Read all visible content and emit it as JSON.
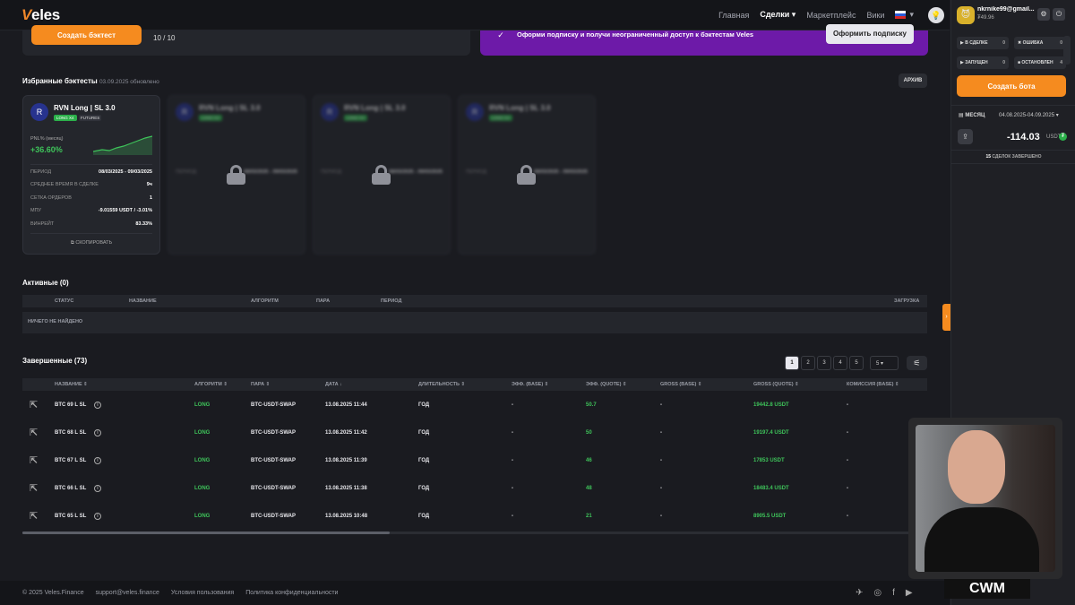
{
  "header": {
    "logo_mark": "V",
    "logo_text": "eles",
    "nav": [
      {
        "label": "Главная"
      },
      {
        "label": "Сделки ▾"
      },
      {
        "label": "Маркетплейс"
      },
      {
        "label": "Вики"
      }
    ],
    "lang_caret": "▾"
  },
  "topcard": {
    "create_backtest": "Создать бэктест",
    "count": "10 / 10"
  },
  "promo": {
    "text": "Оформи подписку и получи неограниченный доступ к бэктестам Veles",
    "button": "Оформить подписку",
    "check": "✓"
  },
  "favorites": {
    "title": "Избранные бэктесты",
    "updated": "03.09.2025 обновлено",
    "archive": "АРХИВ"
  },
  "card": {
    "name": "RVN Long | SL 3.0",
    "tag_long": "LONG X4",
    "tag_futures": "FUTURES",
    "pnl_label": "PNL% (месяц)",
    "pnl_value": "+36.60%",
    "rows": [
      {
        "label": "ПЕРИОД",
        "value": "08/03/2025 - 09/03/2025"
      },
      {
        "label": "СРЕДНЕЕ ВРЕМЯ В СДЕЛКЕ",
        "value": "9ч"
      },
      {
        "label": "СЕТКА ОРДЕРОВ",
        "value": "1"
      },
      {
        "label": "МПУ",
        "value": "-9.01559 USDT / -3.01%"
      },
      {
        "label": "ВИНРЕЙТ",
        "value": "83.33%"
      }
    ],
    "copy": "СКОПИРОВАТЬ",
    "icon": "R"
  },
  "locked_card": {
    "name": "RVN Long | SL 3.0",
    "tag": "LONG X4",
    "row_label": "ПЕРИОД",
    "row_value": "08/03/2025 - 09/03/2025"
  },
  "active": {
    "title": "Активные (0)",
    "columns": [
      "СТАТУС",
      "НАЗВАНИЕ",
      "АЛГОРИТМ",
      "ПАРА",
      "ПЕРИОД",
      "ЗАГРУЗКА"
    ],
    "empty": "НИЧЕГО НЕ НАЙДЕНО"
  },
  "completed": {
    "title": "Завершенные (73)",
    "pages": [
      "1",
      "2",
      "3",
      "4",
      "5"
    ],
    "page_size": "5 ▾",
    "filter_icon": "⚟",
    "columns": [
      "НАЗВАНИЕ ⇕",
      "АЛГОРИТМ ⇕",
      "ПАРА ⇕",
      "ДАТА ↓",
      "ДЛИТЕЛЬНОСТЬ ⇕",
      "ЭФФ. (BASE) ⇕",
      "ЭФФ. (QUOTE) ⇕",
      "GROSS (BASE) ⇕",
      "GROSS (QUOTE) ⇕",
      "КОМИССИЯ (BASE) ⇕"
    ],
    "rows": [
      {
        "name": "BTC 69 L SL",
        "algo": "LONG",
        "pair": "BTC-USDT-SWAP",
        "date": "13.08.2025 11:44",
        "dur": "ГОД",
        "eff_base": "-",
        "eff_quote": "50.7",
        "gross_base": "-",
        "gross_quote": "19442.8 USDT",
        "fee": "-"
      },
      {
        "name": "BTC 68 L SL",
        "algo": "LONG",
        "pair": "BTC-USDT-SWAP",
        "date": "13.08.2025 11:42",
        "dur": "ГОД",
        "eff_base": "-",
        "eff_quote": "50",
        "gross_base": "-",
        "gross_quote": "19197.4 USDT",
        "fee": "-"
      },
      {
        "name": "BTC 67 L SL",
        "algo": "LONG",
        "pair": "BTC-USDT-SWAP",
        "date": "13.08.2025 11:39",
        "dur": "ГОД",
        "eff_base": "-",
        "eff_quote": "46",
        "gross_base": "-",
        "gross_quote": "17853 USDT",
        "fee": "-"
      },
      {
        "name": "BTC 66 L SL",
        "algo": "LONG",
        "pair": "BTC-USDT-SWAP",
        "date": "13.08.2025 11:38",
        "dur": "ГОД",
        "eff_base": "-",
        "eff_quote": "48",
        "gross_base": "-",
        "gross_quote": "18483.4 USDT",
        "fee": "-"
      },
      {
        "name": "BTC 65 L SL",
        "algo": "LONG",
        "pair": "BTC-USDT-SWAP",
        "date": "13.08.2025 10:48",
        "dur": "ГОД",
        "eff_base": "-",
        "eff_quote": "21",
        "gross_base": "-",
        "gross_quote": "8905.5 USDT",
        "fee": "-"
      }
    ]
  },
  "footer": {
    "links": [
      "© 2025 Veles.Finance",
      "support@veles.finance",
      "Условия пользования",
      "Политика конфиденциальности"
    ],
    "social": [
      "✈",
      "◎",
      "f",
      "▶"
    ]
  },
  "sidebar": {
    "email": "nkrnike99@gmail...",
    "balance": "₮49.96",
    "stats": [
      {
        "label": "▶ В СДЕЛКЕ",
        "n": "0"
      },
      {
        "label": "✖ ОШИБКА",
        "n": "0"
      },
      {
        "label": "▶ ЗАПУЩЕН",
        "n": "0"
      },
      {
        "label": "■ ОСТАНОВЛЕН",
        "n": "4"
      }
    ],
    "create_bot": "Создать бота",
    "period": "▤ МЕСЯЦ",
    "range": "04.08.2025-04.09.2025 ▾",
    "pnl": "-114.03",
    "unit": "USDT",
    "deals_n": "15",
    "deals_label": "СДЕЛОК ЗАВЕРШЕНО",
    "share_icon": "⇪"
  },
  "overlay": {
    "brand": "CWM"
  },
  "colors": {
    "accent": "#f58b1f",
    "promo": "#6d1aa8",
    "positive": "#3ec35a"
  }
}
